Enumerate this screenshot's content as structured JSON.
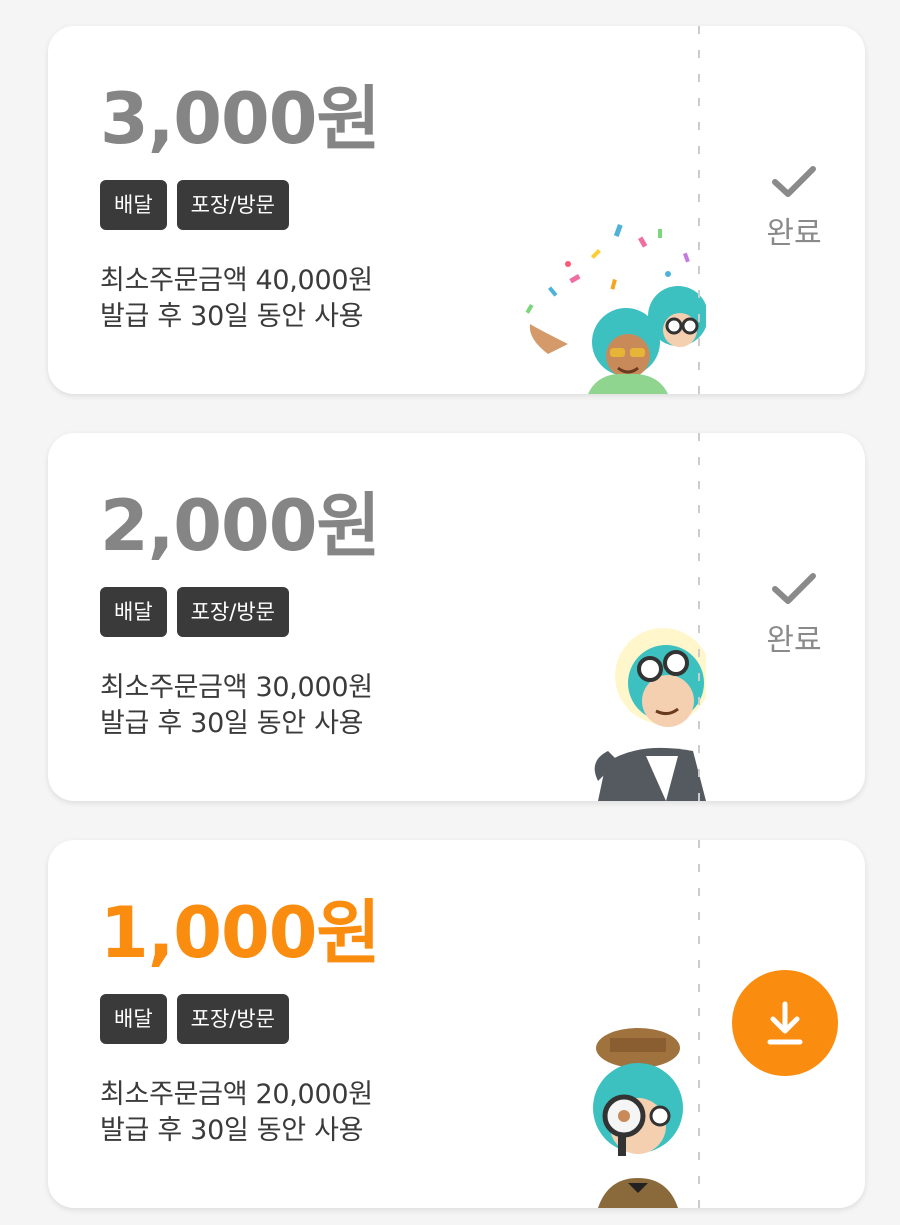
{
  "coupons": [
    {
      "amount": "3,000원",
      "tags": [
        "배달",
        "포장/방문"
      ],
      "min_order": "최소주문금액 40,000원",
      "validity": "발급 후 30일 동안 사용",
      "state": "claimed",
      "status_label": "완료",
      "status_icon": "check-icon",
      "illustration": "celebrating-characters"
    },
    {
      "amount": "2,000원",
      "tags": [
        "배달",
        "포장/방문"
      ],
      "min_order": "최소주문금액 30,000원",
      "validity": "발급 후 30일 동안 사용",
      "state": "claimed",
      "status_label": "완료",
      "status_icon": "check-icon",
      "illustration": "thinking-character"
    },
    {
      "amount": "1,000원",
      "tags": [
        "배달",
        "포장/방문"
      ],
      "min_order": "최소주문금액 20,000원",
      "validity": "발급 후 30일 동안 사용",
      "state": "available",
      "status_icon": "download-icon",
      "illustration": "detective-character"
    }
  ],
  "colors": {
    "accent": "#fa8c0f",
    "inactive_amount": "#858585",
    "tag_bg": "#3a3a3a"
  }
}
